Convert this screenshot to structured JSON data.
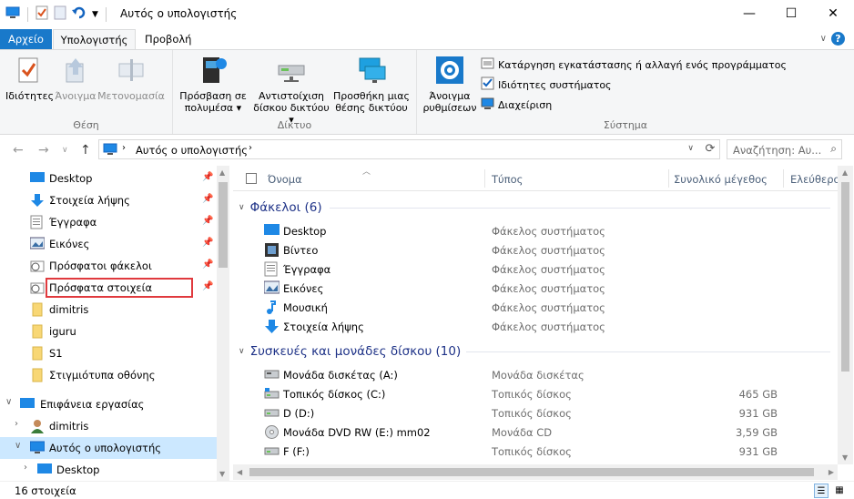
{
  "window": {
    "title": "Αυτός ο υπολογιστής",
    "minimize": "—",
    "maximize": "☐",
    "close": "✕"
  },
  "ribbon_tabs": {
    "file": "Αρχείο",
    "computer": "Υπολογιστής",
    "view": "Προβολή"
  },
  "ribbon": {
    "location": {
      "label": "Θέση",
      "properties": "Ιδιότητες",
      "open": "Άνοιγμα",
      "rename": "Μετονομασία"
    },
    "network": {
      "label": "Δίκτυο",
      "media_access_1": "Πρόσβαση σε",
      "media_access_2": "πολυμέσα",
      "map_drive_1": "Αντιστοίχιση",
      "map_drive_2": "δίσκου δικτύου",
      "add_location_1": "Προσθήκη μιας",
      "add_location_2": "θέσης δικτύου"
    },
    "system": {
      "label": "Σύστημα",
      "open_settings_1": "Άνοιγμα",
      "open_settings_2": "ρυθμίσεων",
      "uninstall": "Κατάργηση εγκατάστασης ή αλλαγή ενός προγράμματος",
      "system_properties": "Ιδιότητες συστήματος",
      "manage": "Διαχείριση"
    }
  },
  "address": {
    "path": "Αυτός ο υπολογιστής",
    "search_placeholder": "Αναζήτηση: Αυ..."
  },
  "nav": {
    "quick_access": [
      {
        "label": "Desktop",
        "pinned": true
      },
      {
        "label": "Στοιχεία λήψης",
        "pinned": true
      },
      {
        "label": "Έγγραφα",
        "pinned": true
      },
      {
        "label": "Εικόνες",
        "pinned": true
      },
      {
        "label": "Πρόσφατοι φάκελοι",
        "pinned": true
      },
      {
        "label": "Πρόσφατα στοιχεία",
        "pinned": true
      },
      {
        "label": "dimitris",
        "pinned": false
      },
      {
        "label": "iguru",
        "pinned": false
      },
      {
        "label": "S1",
        "pinned": false
      },
      {
        "label": "Στιγμιότυπα οθόνης",
        "pinned": false
      }
    ],
    "desktop_root": "Επιφάνεια εργασίας",
    "user": "dimitris",
    "this_pc": "Αυτός ο υπολογιστής",
    "desktop_child": "Desktop"
  },
  "columns": {
    "name": "Όνομα",
    "type": "Τύπος",
    "total_size": "Συνολικό μέγεθος",
    "free": "Ελεύθερο"
  },
  "folders_group": "Φάκελοι (6)",
  "folders": [
    {
      "name": "Desktop",
      "type": "Φάκελος συστήματος",
      "icon": "desktop-icon"
    },
    {
      "name": "Βίντεο",
      "type": "Φάκελος συστήματος",
      "icon": "video-icon"
    },
    {
      "name": "Έγγραφα",
      "type": "Φάκελος συστήματος",
      "icon": "documents-icon"
    },
    {
      "name": "Εικόνες",
      "type": "Φάκελος συστήματος",
      "icon": "pictures-icon"
    },
    {
      "name": "Μουσική",
      "type": "Φάκελος συστήματος",
      "icon": "music-icon"
    },
    {
      "name": "Στοιχεία λήψης",
      "type": "Φάκελος συστήματος",
      "icon": "downloads-icon"
    }
  ],
  "devices_group": "Συσκευές και μονάδες δίσκου (10)",
  "devices": [
    {
      "name": "Μονάδα δισκέτας (A:)",
      "type": "Μονάδα δισκέτας",
      "size": "",
      "icon": "floppy-icon"
    },
    {
      "name": "Τοπικός δίσκος (C:)",
      "type": "Τοπικός δίσκος",
      "size": "465 GB",
      "icon": "hdd-icon"
    },
    {
      "name": "D (D:)",
      "type": "Τοπικός δίσκος",
      "size": "931 GB",
      "icon": "hdd-icon"
    },
    {
      "name": "Μονάδα DVD RW (E:) mm02",
      "type": "Μονάδα CD",
      "size": "3,59 GB",
      "icon": "dvd-icon"
    },
    {
      "name": "F (F:)",
      "type": "Τοπικός δίσκος",
      "size": "931 GB",
      "icon": "hdd-icon"
    }
  ],
  "status": {
    "count": "16 στοιχεία"
  },
  "colors": {
    "accent": "#1979ca",
    "group_header": "#1e3287",
    "selection": "#cce8ff",
    "highlight": "#e03a3e"
  }
}
